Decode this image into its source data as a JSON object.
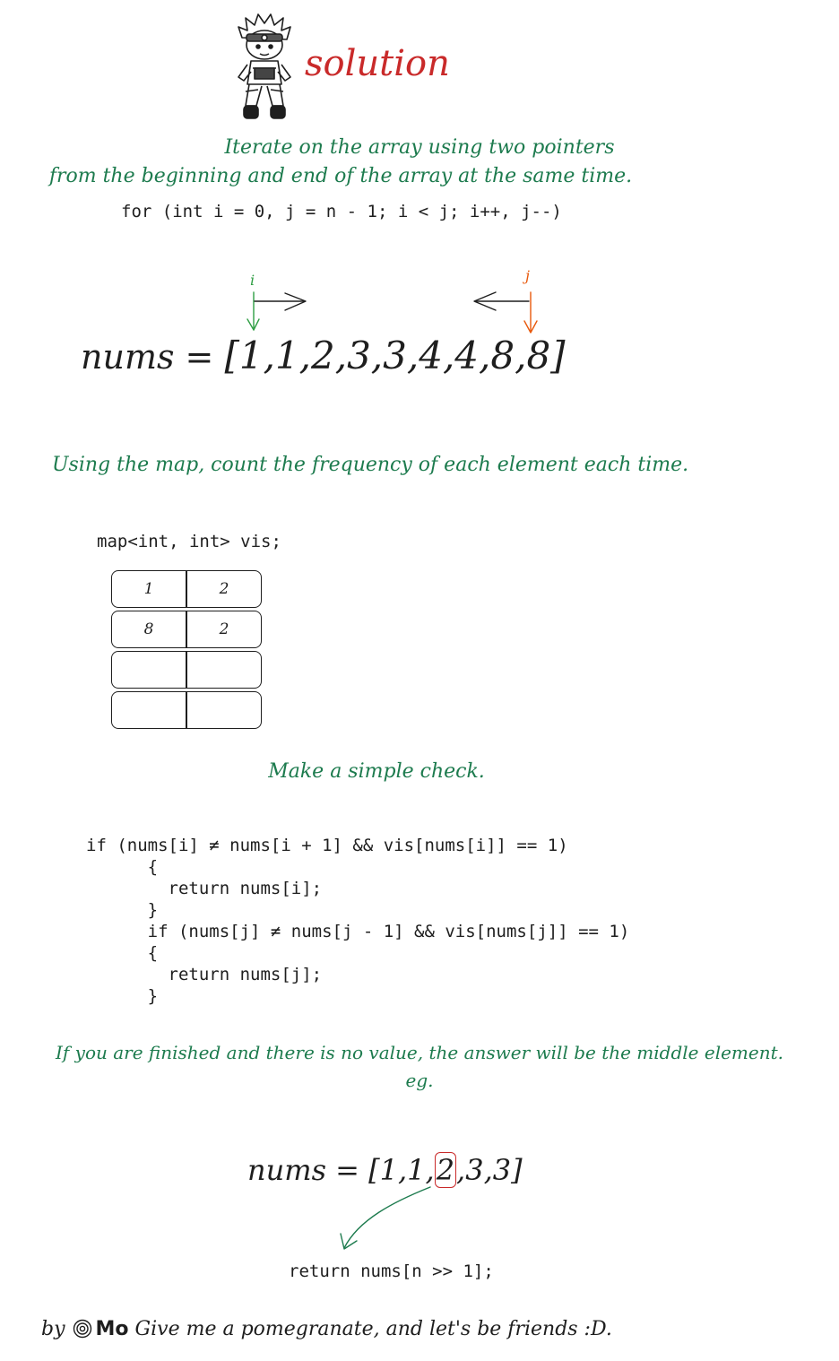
{
  "title": "solution",
  "step1": {
    "line1": "Iterate on the array using two pointers",
    "line2": "from the beginning and end of the array at the same time.",
    "code": "for (int i = 0, j = n - 1; i < j; i++, j--)"
  },
  "pointers": {
    "i_label": "i",
    "j_label": "j"
  },
  "array1": {
    "prefix": "nums = ",
    "values": "[1,1,2,3,3,4,4,8,8]"
  },
  "step2": {
    "text": "Using the map, count the frequency of each element each time.",
    "code": "map<int, int> vis;",
    "table": [
      {
        "key": "1",
        "value": "2"
      },
      {
        "key": "8",
        "value": "2"
      },
      {
        "key": "",
        "value": ""
      },
      {
        "key": "",
        "value": ""
      }
    ]
  },
  "step3": {
    "text": "Make a simple check.",
    "code": [
      "if (nums[i] ≠ nums[i + 1] && vis[nums[i]] == 1)",
      "      {",
      "        return nums[i];",
      "      }",
      "      if (nums[j] ≠ nums[j - 1] && vis[nums[j]] == 1)",
      "      {",
      "        return nums[j];",
      "      }"
    ]
  },
  "step4": {
    "line1": "If you are finished and there is no value, the answer will be the middle element.",
    "line2": "eg."
  },
  "array2": {
    "prefix": "nums = ",
    "open": "[1,1,",
    "highlight": "2",
    "close": ",3,3]",
    "return_code": "return nums[n >> 1];"
  },
  "footer": {
    "by": "by",
    "author": "Mo",
    "tagline": "Give me a pomegranate, and let's be friends :D."
  },
  "colors": {
    "title": "#c92a2a",
    "note": "#1d7b4e",
    "pointer_i": "#2f9e44",
    "pointer_j": "#e8590c"
  }
}
